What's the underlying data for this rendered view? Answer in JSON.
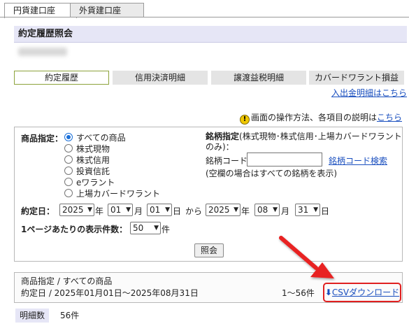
{
  "tabs": {
    "yen": "円貨建口座",
    "foreign": "外貨建口座"
  },
  "page_title": "約定履歴照会",
  "subtabs": [
    "約定履歴",
    "信用決済明細",
    "譲渡益税明細",
    "カバードワラント損益"
  ],
  "deposit_link": "入出金明細はこちら",
  "help_note": "画面の操作方法、各項目の説明は",
  "help_link": "こちら",
  "product_label": "商品指定：",
  "product_options": [
    "すべての商品",
    "株式現物",
    "株式信用",
    "投資信託",
    "eワラント",
    "上場カバードワラント"
  ],
  "product_selected_index": 0,
  "brand_label": "銘柄指定",
  "brand_desc": "(株式現物･株式信用･上場カバードワラント",
  "brand_desc2": "のみ)：",
  "brand_code_label": "銘柄コード",
  "brand_code_value": "",
  "brand_search_link": "銘柄コード検索",
  "brand_hint": "(空欄の場合はすべての銘柄を表示)",
  "date_label": "約定日：",
  "date_from": {
    "year": "2025",
    "month": "01",
    "day": "01"
  },
  "date_to": {
    "year": "2025",
    "month": "08",
    "day": "31"
  },
  "date_units": {
    "year": "年",
    "month": "月",
    "day": "日",
    "range": "から"
  },
  "per_page_label": "1ページあたりの表示件数：",
  "per_page_value": "50",
  "per_page_unit": "件",
  "submit_label": "照会",
  "result": {
    "product_line": "商品指定 / すべての商品",
    "date_line": "約定日 / 2025年01月01日～2025年08月31日",
    "range": "1～56件",
    "csv_link": "CSVダウンロード"
  },
  "count_label": "明細数",
  "count_value": "56件",
  "colors": {
    "accent_border": "#8da33b",
    "title_bg": "#e6e6f6",
    "annotation_red": "#e02020",
    "link": "#1a4fbf"
  },
  "icons": [
    "info-icon",
    "download-icon",
    "chevron-down-icon",
    "red-pointer-arrow"
  ]
}
